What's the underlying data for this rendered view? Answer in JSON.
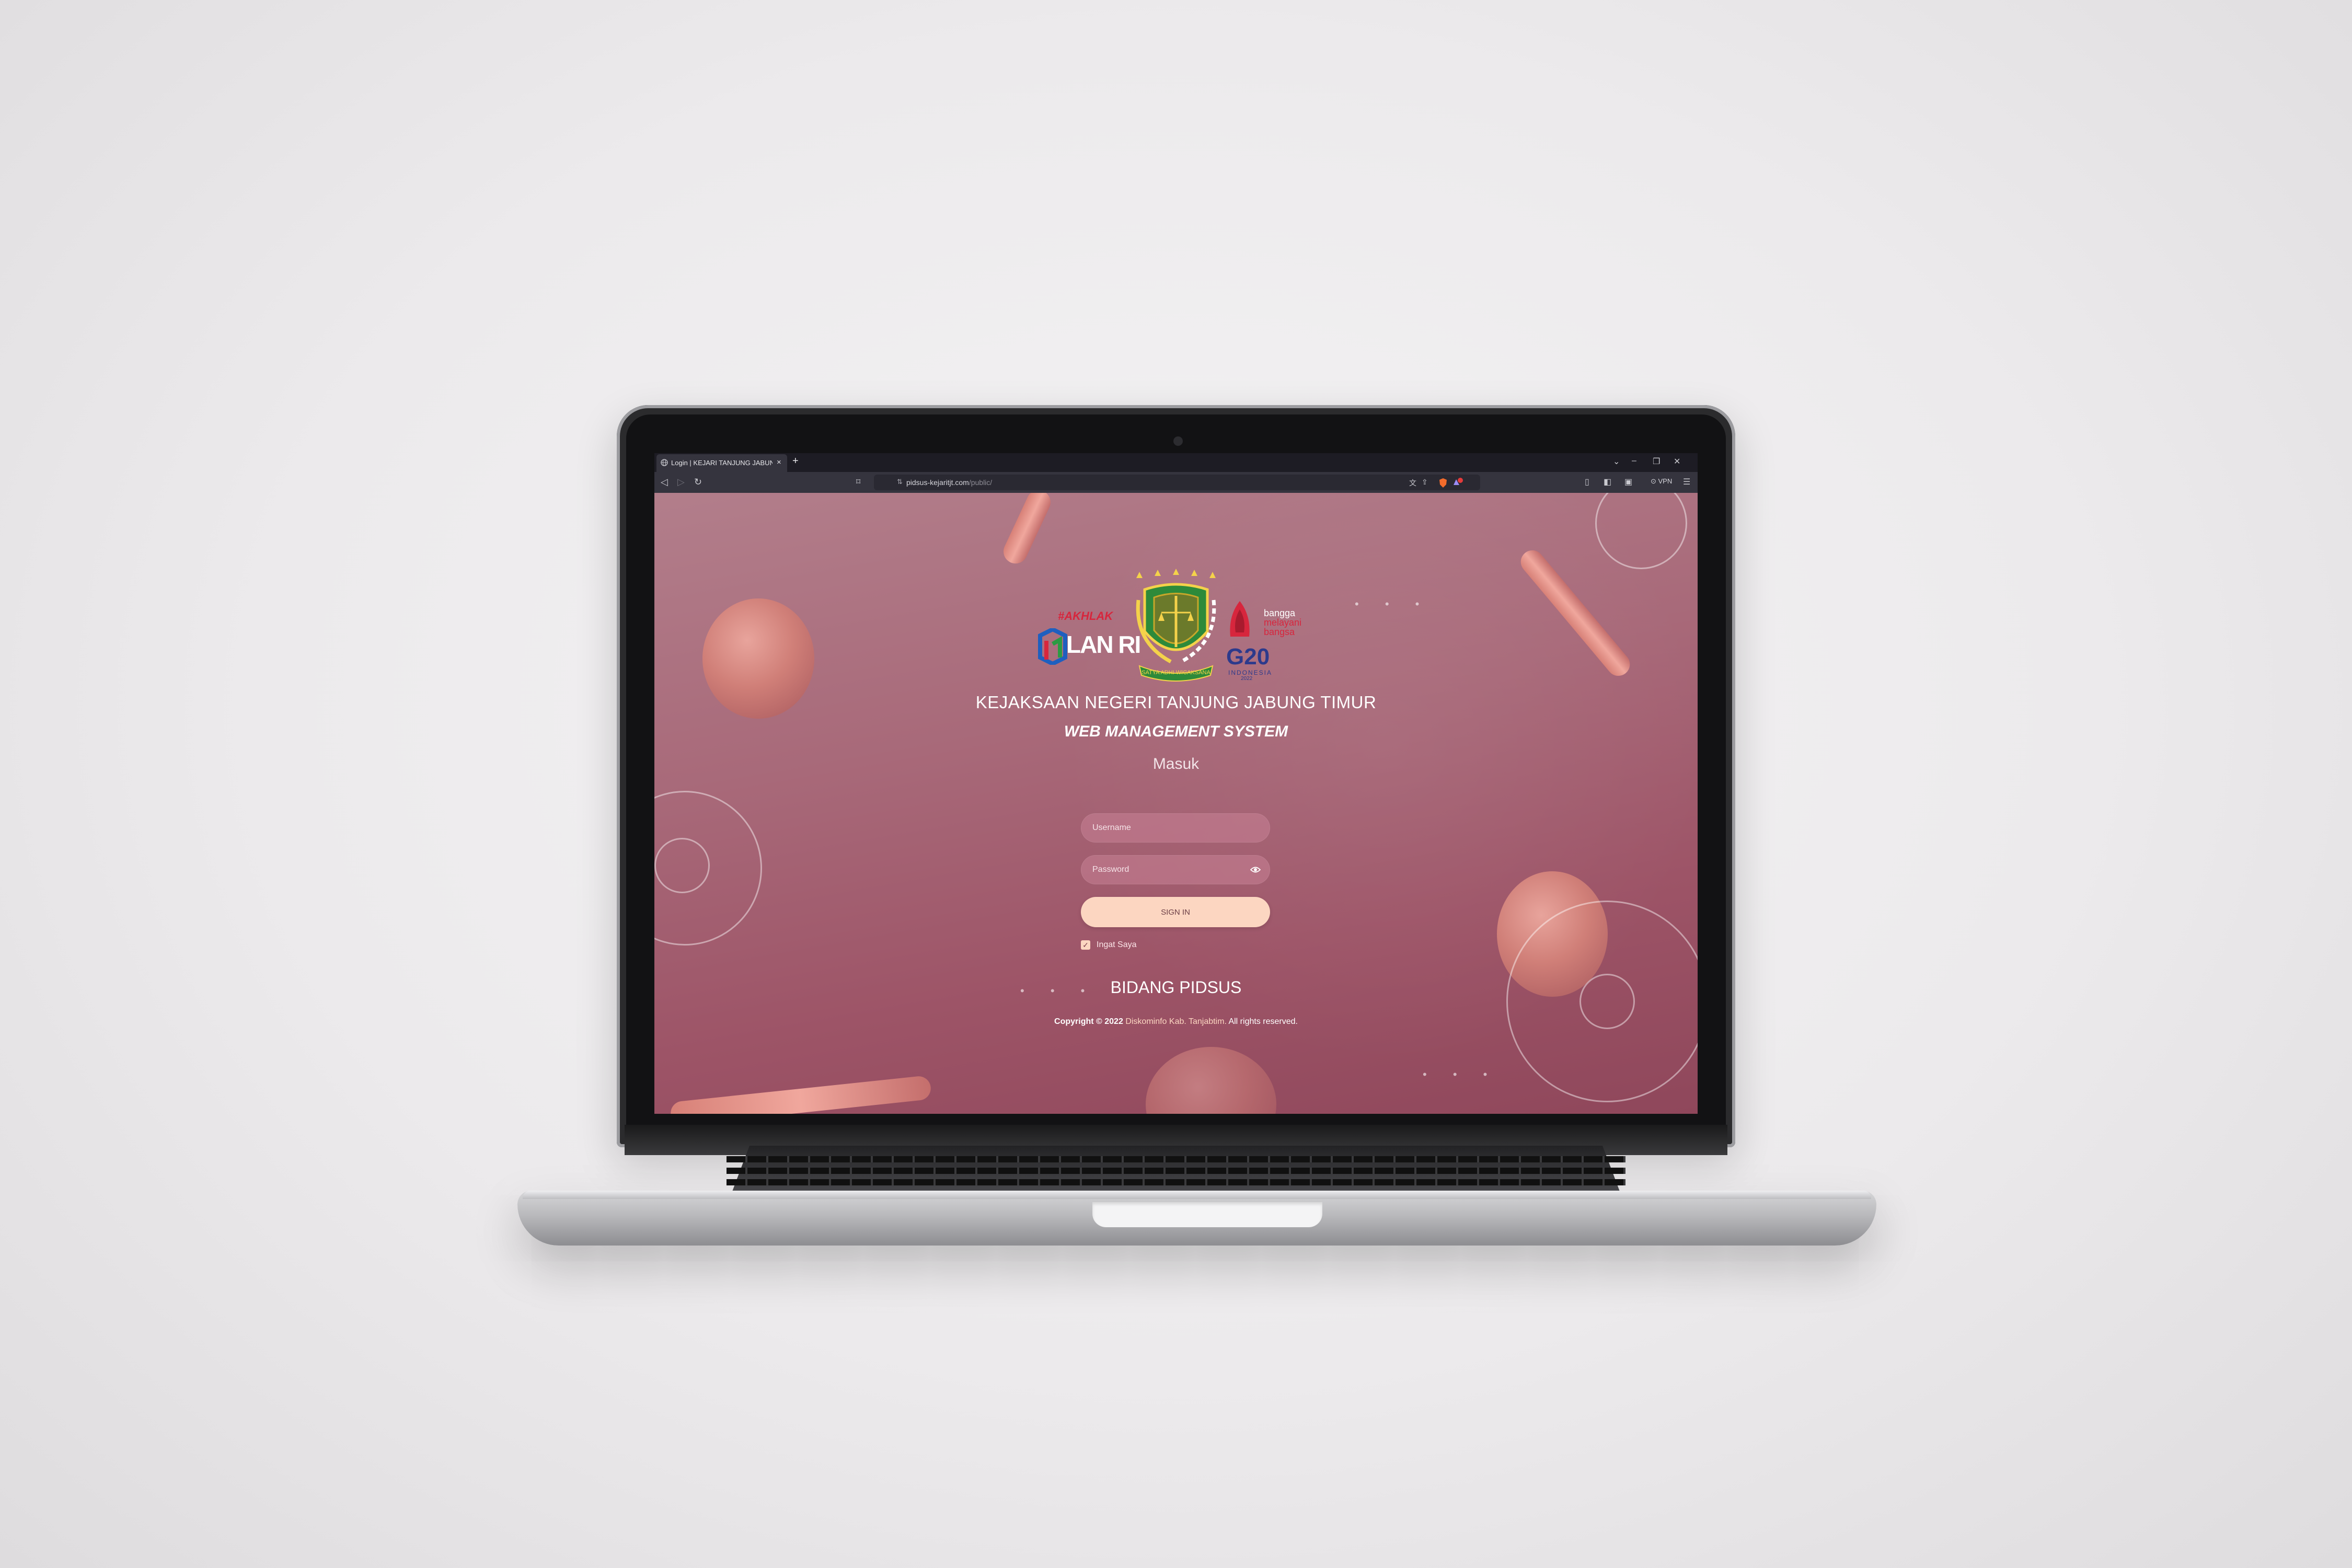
{
  "browser": {
    "tab_title": "Login | KEJARI TANJUNG JABUNG",
    "tab_close": "×",
    "new_tab": "+",
    "url_host": "pidsus-kejaritjt.com",
    "url_path": "/public/",
    "vpn_label": "VPN"
  },
  "logos": {
    "left_tag": "#AKHLAK",
    "left_name": "LAN RI",
    "right_tag_line1": "bangga",
    "right_tag_line2": "melayani",
    "right_tag_line3": "bangsa",
    "right_name": "G20",
    "right_sub": "INDONESIA",
    "right_year": "2022",
    "emblem_motto": "SATYA ADHI WICAKSANA"
  },
  "header": {
    "institution": "KEJAKSAAN NEGERI TANJUNG JABUNG TIMUR",
    "system_name": "WEB MANAGEMENT SYSTEM"
  },
  "form": {
    "title": "Masuk",
    "username_placeholder": "Username",
    "password_placeholder": "Password",
    "signin_label": "SIGN IN",
    "remember_label": "Ingat Saya",
    "remember_checked": "✓"
  },
  "footer": {
    "department": "BIDANG PIDSUS",
    "copyright_prefix": "Copyright © 2022",
    "copyright_link": "Diskominfo Kab. Tanjabtim.",
    "copyright_suffix": "All rights reserved."
  },
  "colors": {
    "page_bg": "#a86979",
    "accent_button": "#fcd6c1",
    "browser_chrome": "#35343e"
  }
}
